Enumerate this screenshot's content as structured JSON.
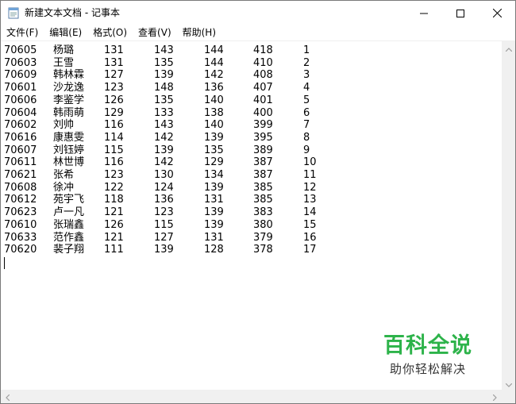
{
  "window": {
    "title": "新建文本文档 - 记事本",
    "icons": {
      "app": "notepad-icon",
      "minimize": "minimize-icon",
      "maximize": "maximize-icon",
      "close": "close-icon"
    }
  },
  "menu": [
    "文件(F)",
    "编辑(E)",
    "格式(O)",
    "查看(V)",
    "帮助(H)"
  ],
  "rows": [
    [
      "70605",
      "杨璐",
      "131",
      "143",
      "144",
      "418",
      "1"
    ],
    [
      "70603",
      "王雪",
      "131",
      "135",
      "144",
      "410",
      "2"
    ],
    [
      "70609",
      "韩林霖",
      "127",
      "139",
      "142",
      "408",
      "3"
    ],
    [
      "70601",
      "沙龙逸",
      "123",
      "148",
      "136",
      "407",
      "4"
    ],
    [
      "70606",
      "李鉴学",
      "126",
      "135",
      "140",
      "401",
      "5"
    ],
    [
      "70604",
      "韩雨萌",
      "129",
      "133",
      "138",
      "400",
      "6"
    ],
    [
      "70602",
      "刘帅",
      "116",
      "143",
      "140",
      "399",
      "7"
    ],
    [
      "70616",
      "康惠雯",
      "114",
      "142",
      "139",
      "395",
      "8"
    ],
    [
      "70607",
      "刘钰婷",
      "115",
      "139",
      "135",
      "389",
      "9"
    ],
    [
      "70611",
      "林世博",
      "116",
      "142",
      "129",
      "387",
      "10"
    ],
    [
      "70621",
      "张希",
      "123",
      "130",
      "134",
      "387",
      "11"
    ],
    [
      "70608",
      "徐冲",
      "122",
      "124",
      "139",
      "385",
      "12"
    ],
    [
      "70612",
      "苑宇飞",
      "118",
      "136",
      "131",
      "385",
      "13"
    ],
    [
      "70623",
      "卢一凡",
      "121",
      "123",
      "139",
      "383",
      "14"
    ],
    [
      "70610",
      "张瑞鑫",
      "126",
      "115",
      "139",
      "380",
      "15"
    ],
    [
      "70633",
      "范作鑫",
      "121",
      "127",
      "131",
      "379",
      "16"
    ],
    [
      "70620",
      "裴子翔",
      "111",
      "139",
      "128",
      "378",
      "17"
    ]
  ],
  "watermark": {
    "title": "百科全说",
    "subtitle": "助你轻松解决",
    "color": "#2db34a"
  }
}
